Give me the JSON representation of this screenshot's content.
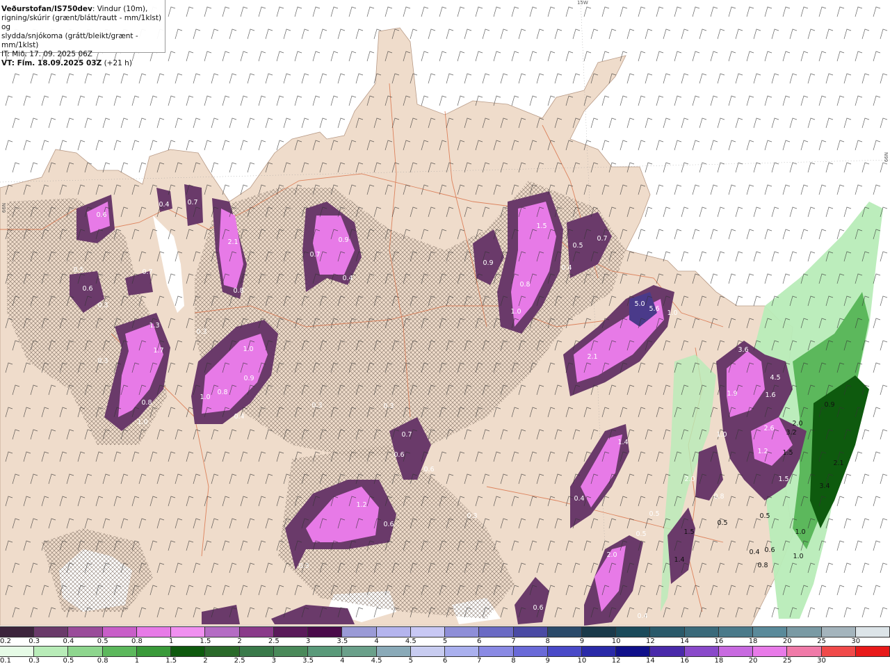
{
  "info": {
    "line1_bold": "Veðurstofan/IS750dev",
    "line1_rest": ": Vindur (10m),",
    "line2": "rigning/skúrir (grænt/blátt/rautt - mm/1klst) og",
    "line3": "slydda/snjókoma (grátt/bleikt/grænt - mm/1klst)",
    "line4": "IT: Mið. 17. 09. 2025 06Z",
    "line5_bold": "VT: Fim. 18.09.2025 03Z",
    "line5_rest": " (+21 h)"
  },
  "graticule": {
    "top": "15W",
    "left": "66N",
    "right": "66N"
  },
  "colors": {
    "sea": "#ffffff",
    "land": "#efdccb",
    "roads": "#d9734a",
    "hatch": "#7a6a5e"
  },
  "precip_labels": [
    "0.6",
    "0.4",
    "0.7",
    "2.1",
    "0.8",
    "0.5",
    "0.6",
    "0.7",
    "0.3",
    "1.3",
    "1.7",
    "0.3",
    "0.8",
    "1.0",
    "1.0",
    "0.8",
    "1.0",
    "0.9",
    "0.3",
    "0.4",
    "0.9",
    "0.7",
    "0.4",
    "1.5",
    "0.5",
    "0.7",
    "0.4",
    "0.9",
    "0.8",
    "1.0",
    "5.0",
    "5.6",
    "1.0",
    "2.1",
    "0.3",
    "0.3",
    "0.7",
    "0.6",
    "0.6",
    "1.2",
    "0.6",
    "0.3",
    "0.3",
    "1.4",
    "0.4",
    "0.5",
    "0.5",
    "2.0",
    "0.6",
    "0.4",
    "3.6",
    "4.5",
    "1.9",
    "1.6",
    "1.0",
    "2.6",
    "2.0",
    "3.2",
    "1.2",
    "1.5",
    "1.5",
    "0.9",
    "2.1",
    "3.4",
    "2.0",
    "0.8",
    "1.5",
    "1.4",
    "0.5",
    "0.5",
    "0.4",
    "0.6",
    "1.0",
    "1.0",
    "0.8"
  ],
  "legend_top": {
    "label": "slydda/snjókoma",
    "ticks": [
      "0.2",
      "0.3",
      "0.4",
      "0.5",
      "0.8",
      "1",
      "1.5",
      "2",
      "2.5",
      "3",
      "3.5",
      "4",
      "4.5",
      "5",
      "6",
      "7",
      "8",
      "9",
      "10",
      "12",
      "14",
      "16",
      "18",
      "20",
      "25",
      "30"
    ],
    "colors": [
      "#3c243c",
      "#6a3a6a",
      "#9a4c9a",
      "#c85ec8",
      "#e77ae7",
      "#f08ff0",
      "#b46cc4",
      "#8a3a8a",
      "#5a1a5a",
      "#4a0a4a",
      "#9a9ad6",
      "#b4b4ee",
      "#c8c8f4",
      "#8e8ed8",
      "#6a6ac4",
      "#4a4aa4",
      "#2a4a6a",
      "#1a3a4a",
      "#1a4a5a",
      "#2a5a6a",
      "#3a6a7a",
      "#4a7a8a",
      "#5a8a9a",
      "#7a9aa4",
      "#a4b4bc",
      "#dce4e8"
    ]
  },
  "legend_bottom": {
    "label": "rigning/skúrir",
    "ticks": [
      "0.1",
      "0.3",
      "0.5",
      "0.8",
      "1",
      "1.5",
      "2",
      "2.5",
      "3",
      "3.5",
      "4",
      "4.5",
      "5",
      "6",
      "7",
      "8",
      "9",
      "10",
      "12",
      "14",
      "16",
      "18",
      "20",
      "25",
      "30"
    ],
    "colors": [
      "#e6fbe6",
      "#b8ecb8",
      "#8ed68e",
      "#5cb85c",
      "#3a9a3a",
      "#0e5a0e",
      "#2a6a2a",
      "#3a7a4a",
      "#4a8a5a",
      "#5a9a7a",
      "#6aa08a",
      "#8aaab8",
      "#c8ccf0",
      "#aab0ee",
      "#8a8ae4",
      "#6a6ad8",
      "#4a4ac8",
      "#2a2aa8",
      "#10108a",
      "#4a2aaa",
      "#8a4aca",
      "#c86ae0",
      "#e87ae8",
      "#f07aa8",
      "#f04a4a",
      "#e81a1a"
    ]
  }
}
